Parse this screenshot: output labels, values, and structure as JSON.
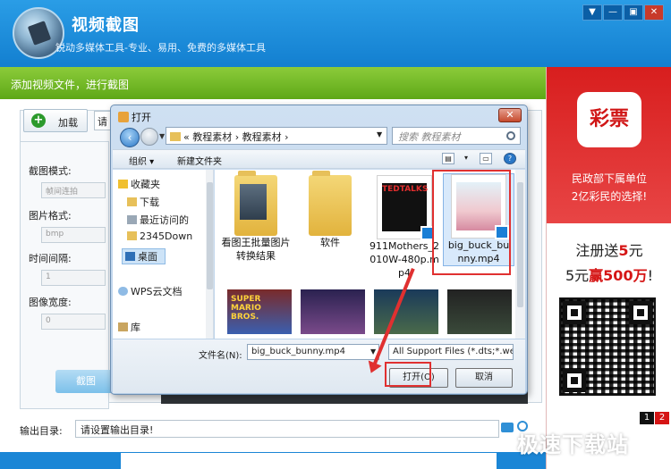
{
  "app": {
    "title": "视频截图",
    "subtitle": "锐动多媒体工具-专业、易用、免费的多媒体工具",
    "window_controls": [
      "▼",
      "—",
      "▣",
      "✕"
    ]
  },
  "step_bar": "添加视频文件，进行截图",
  "toolbar": {
    "add_label": "加载",
    "add_icon": "+",
    "input_text": "请"
  },
  "settings": {
    "mode_label": "截图模式:",
    "mode_value": "帧间连拍",
    "format_label": "图片格式:",
    "format_value": "bmp",
    "interval_label": "时间间隔:",
    "interval_value": "1",
    "width_label": "图像宽度:",
    "width_value": "0"
  },
  "capture_label": "截图",
  "output": {
    "label": "输出目录:",
    "value": "请设置输出目录!"
  },
  "ad": {
    "badge": "彩票",
    "line1": "民政部下属单位",
    "line2": "2亿彩民的选择!",
    "promo1_pre": "注册送",
    "promo1_num": "5",
    "promo1_post": "元",
    "promo2_pre": "5元",
    "promo2_red": "赢500万",
    "promo2_post": "!",
    "pages": [
      "1",
      "2"
    ]
  },
  "dialog": {
    "title": "打开",
    "close": "✕",
    "address": [
      "«",
      "教程素材",
      "›",
      "教程素材",
      "›"
    ],
    "search_placeholder": "搜索 教程素材",
    "cmd_organize": "组织 ▾",
    "cmd_new_folder": "新建文件夹",
    "nav_items": [
      "收藏夹",
      "下载",
      "最近访问的",
      "2345Down",
      "桌面",
      "WPS云文档",
      "库"
    ],
    "files": [
      {
        "name": "看图王批量图片转换结果"
      },
      {
        "name": "软件"
      },
      {
        "name": "911Mothers_2010W-480p.mp4",
        "thumb_text": "TEDTALKS"
      },
      {
        "name": "big_buck_bunny.mp4"
      }
    ],
    "row2_thumb_text": "SUPER MARIO BROS.",
    "filename_label": "文件名(N):",
    "filename_value": "big_buck_bunny.mp4",
    "filetype_value": "All Support Files (*.dts;*.web",
    "open_label": "打开(O)",
    "cancel_label": "取消"
  },
  "watermark": "极速下载站",
  "colors": {
    "accent_blue": "#1b86d6",
    "step_green": "#6cb51f",
    "highlight_red": "#e03030",
    "ad_red": "#d81e1e"
  }
}
